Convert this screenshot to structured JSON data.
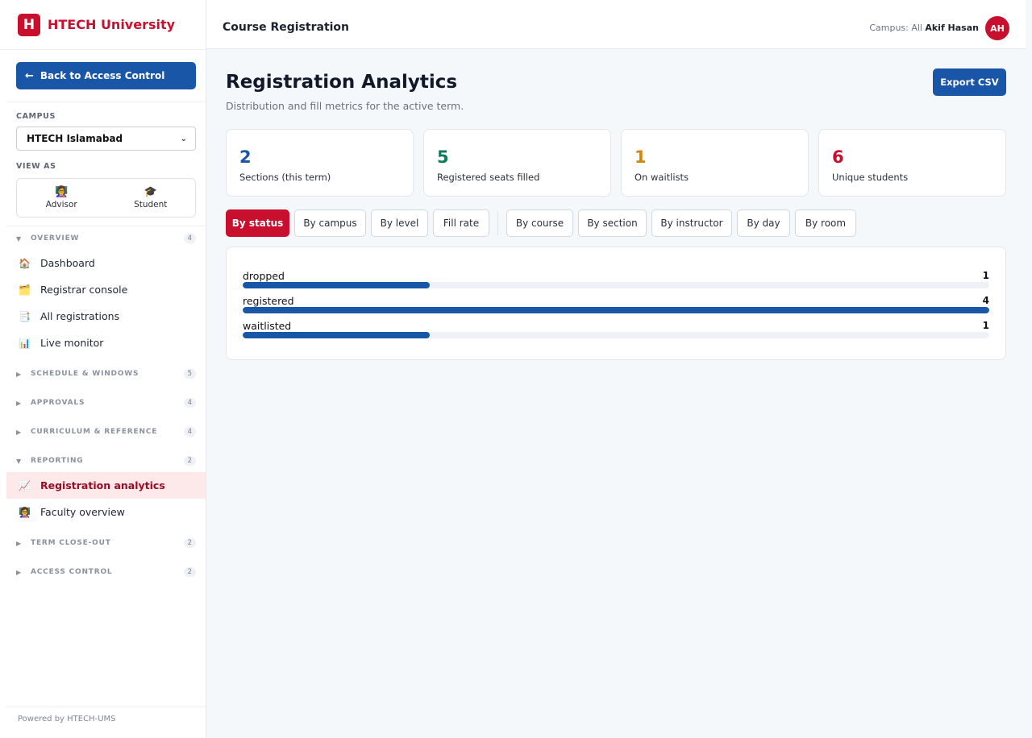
{
  "brand": {
    "logo_letter": "H",
    "name": "HTECH University"
  },
  "sidebar": {
    "back_label": "Back to Access Control",
    "back_icon": "←",
    "campus_label": "CAMPUS",
    "campus_value": "HTECH Islamabad",
    "viewas_label": "VIEW AS",
    "viewas_options": [
      {
        "icon": "👩‍🏫",
        "label": "Advisor"
      },
      {
        "icon": "🎓",
        "label": "Student"
      }
    ],
    "groups": [
      {
        "label": "OVERVIEW",
        "count": "4",
        "expanded": true,
        "items": [
          {
            "icon": "🏠",
            "label": "Dashboard"
          },
          {
            "icon": "🗂️",
            "label": "Registrar console"
          },
          {
            "icon": "📑",
            "label": "All registrations"
          },
          {
            "icon": "📊",
            "label": "Live monitor"
          }
        ]
      },
      {
        "label": "SCHEDULE & WINDOWS",
        "count": "5",
        "expanded": false
      },
      {
        "label": "APPROVALS",
        "count": "4",
        "expanded": false
      },
      {
        "label": "CURRICULUM & REFERENCE",
        "count": "4",
        "expanded": false
      },
      {
        "label": "REPORTING",
        "count": "2",
        "expanded": true,
        "items": [
          {
            "icon": "📈",
            "label": "Registration analytics",
            "active": true
          },
          {
            "icon": "👩‍🏫",
            "label": "Faculty overview"
          }
        ]
      },
      {
        "label": "TERM CLOSE-OUT",
        "count": "2",
        "expanded": false
      },
      {
        "label": "ACCESS CONTROL",
        "count": "2",
        "expanded": false
      }
    ],
    "powered_by": "Powered by HTECH-UMS"
  },
  "topbar": {
    "title": "Course Registration",
    "campus_indicator": "Campus: All",
    "user_name": "Akif Hasan",
    "user_initials": "AH"
  },
  "main": {
    "title": "Registration Analytics",
    "subtitle": "Distribution and fill metrics for the active term.",
    "export_label": "Export CSV",
    "stats": [
      {
        "value": "2",
        "label": "Sections (this term)",
        "color": "#1a56a8"
      },
      {
        "value": "5",
        "label": "Registered seats filled",
        "color": "#0f7a5a"
      },
      {
        "value": "1",
        "label": "On waitlists",
        "color": "#d4860b"
      },
      {
        "value": "6",
        "label": "Unique students",
        "color": "#c8102e"
      }
    ],
    "tabs": [
      {
        "label": "By status",
        "active": true
      },
      {
        "label": "By campus"
      },
      {
        "label": "By level"
      },
      {
        "label": "Fill rate"
      },
      {
        "label": "By course"
      },
      {
        "label": "By section"
      },
      {
        "label": "By instructor"
      },
      {
        "label": "By day"
      },
      {
        "label": "By room"
      }
    ]
  },
  "chart_data": {
    "type": "bar",
    "orientation": "horizontal",
    "categories": [
      "dropped",
      "registered",
      "waitlisted"
    ],
    "values": [
      1,
      4,
      1
    ],
    "xlim": [
      0,
      4
    ]
  }
}
